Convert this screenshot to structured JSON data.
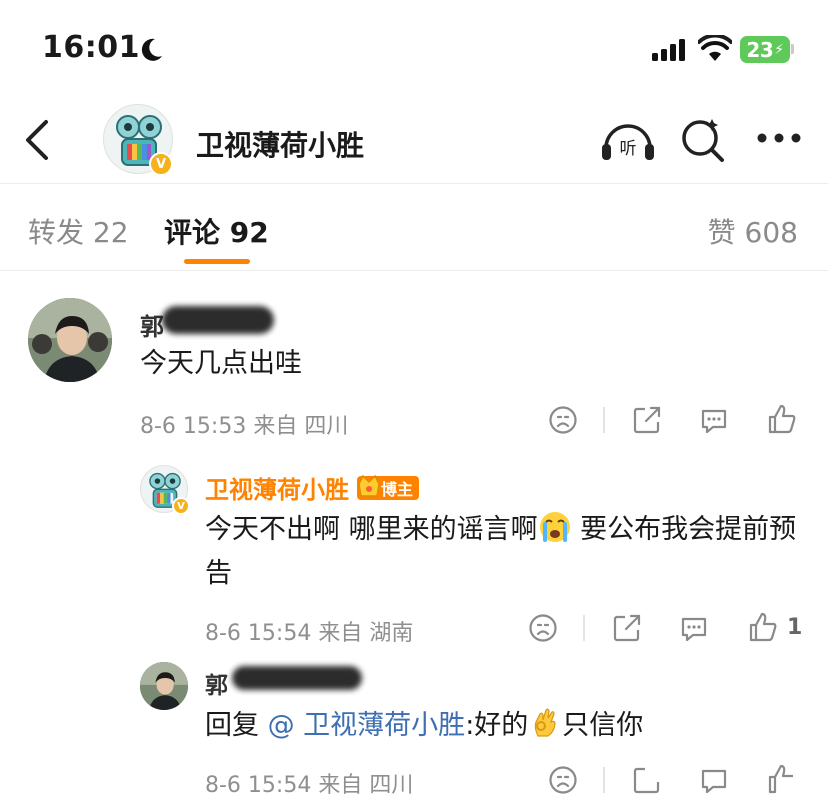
{
  "status_bar": {
    "time": "16:01",
    "battery": "23"
  },
  "header": {
    "account_name": "卫视薄荷小胜",
    "listen_label": "听"
  },
  "tabs": {
    "repost": "转发 22",
    "comment": "评论 92",
    "like": "赞 608"
  },
  "comments": [
    {
      "name_visible": "郭",
      "text": "今天几点出哇",
      "meta": "8-6 15:53 来自 四川"
    },
    {
      "name": "卫视薄荷小胜",
      "badge": "博主",
      "text_part1": "今天不出啊 哪里来的谣言啊",
      "text_part2": " 要公布我会提前预告",
      "meta": "8-6 15:54 来自 湖南",
      "like_count": "1"
    },
    {
      "name_visible": "郭",
      "reply_prefix": "回复",
      "mention": "@ 卫视薄荷小胜",
      "reply_text": ":好的",
      "reply_suffix": "只信你",
      "meta": "8-6 15:54 来自 四川"
    }
  ],
  "colors": {
    "accent": "#ff8200",
    "mention": "#3d6fb2",
    "verified": "#f6b21a",
    "battery": "#5fc95a"
  }
}
